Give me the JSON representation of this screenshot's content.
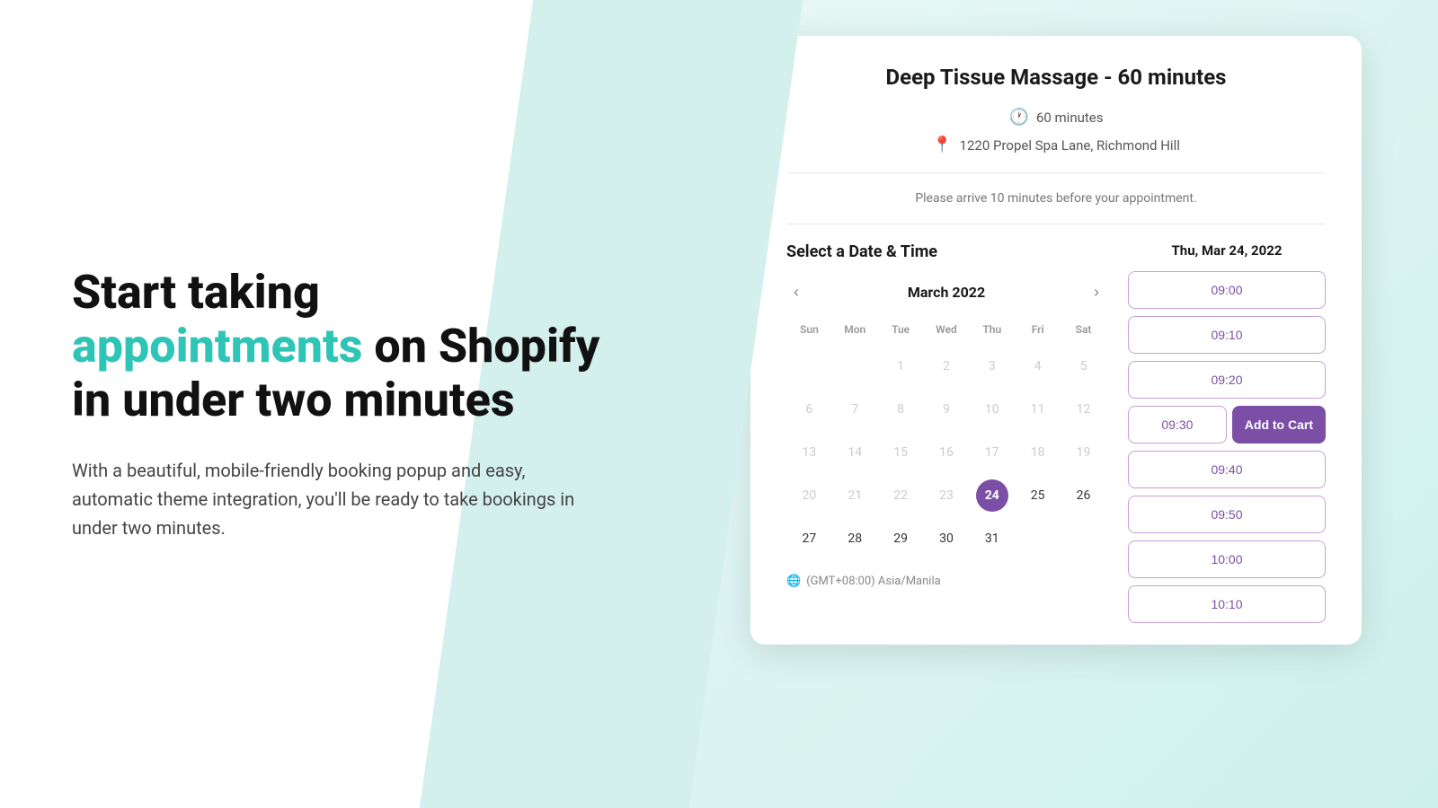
{
  "left": {
    "headline_part1": "Start taking ",
    "headline_accent": "appointments",
    "headline_part2": " on Shopify in under two minutes",
    "subtext": "With a beautiful, mobile-friendly booking popup and easy, automatic theme integration, you'll be ready to take bookings in under two minutes."
  },
  "card": {
    "title": "Deep Tissue Massage - 60 minutes",
    "duration_icon": "🕐",
    "duration": "60 minutes",
    "location_icon": "📍",
    "location": "1220 Propel Spa Lane, Richmond Hill",
    "notice": "Please arrive 10 minutes before your appointment.",
    "section_title": "Select a Date & Time",
    "calendar": {
      "month_label": "March 2022",
      "prev_label": "‹",
      "next_label": "›",
      "day_headers": [
        "Sun",
        "Mon",
        "Tue",
        "Wed",
        "Thu",
        "Fri",
        "Sat"
      ],
      "weeks": [
        [
          null,
          null,
          "1",
          "2",
          "3",
          "4",
          "5"
        ],
        [
          "6",
          "7",
          "8",
          "9",
          "10",
          "11",
          "12"
        ],
        [
          "13",
          "14",
          "15",
          "16",
          "17",
          "18",
          "19"
        ],
        [
          "20",
          "21",
          "22",
          "23",
          "24",
          "25",
          "26"
        ],
        [
          "27",
          "28",
          "29",
          "30",
          "31",
          null,
          null
        ]
      ],
      "selected_day": "24",
      "disabled_days": [
        "1",
        "2",
        "3",
        "4",
        "5",
        "6",
        "7",
        "8",
        "9",
        "10",
        "11",
        "12",
        "13",
        "14",
        "15",
        "16",
        "17",
        "18",
        "19",
        "20",
        "21",
        "22",
        "23"
      ],
      "timezone": "(GMT+08:00) Asia/Manila",
      "globe_icon": "🌐"
    },
    "selected_date_label": "Thu, Mar 24, 2022",
    "time_slots": [
      {
        "time": "09:00",
        "type": "single"
      },
      {
        "time": "09:10",
        "type": "single"
      },
      {
        "time": "09:20",
        "type": "single"
      },
      {
        "time": "09:30",
        "type": "split",
        "add_to_cart": "Add to Cart"
      },
      {
        "time": "09:40",
        "type": "single"
      },
      {
        "time": "09:50",
        "type": "single"
      },
      {
        "time": "10:00",
        "type": "single"
      },
      {
        "time": "10:10",
        "type": "single"
      }
    ]
  }
}
